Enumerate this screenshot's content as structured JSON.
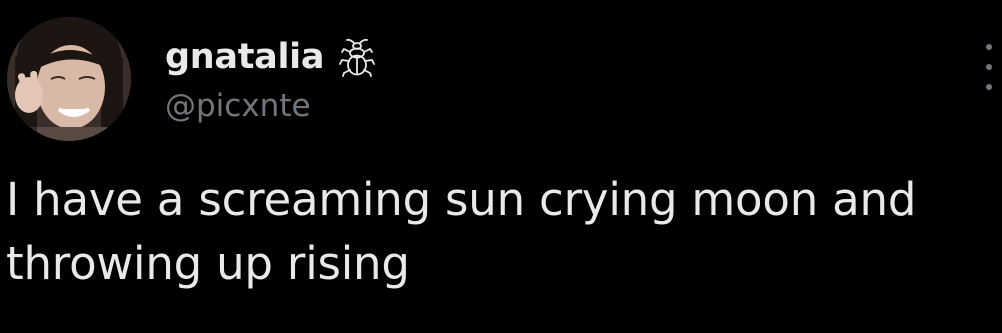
{
  "author": {
    "display_name": "gnatalia",
    "handle": "@picxnte",
    "name_emoji": "beetle-icon",
    "avatar": "profile-photo"
  },
  "post": {
    "text_line_1": "I have a screaming sun crying moon and",
    "text_line_2": "throwing up rising"
  },
  "menu": {
    "icon": "more-vertical-icon"
  },
  "colors": {
    "background": "#000000",
    "primary_text": "#e7e9ea",
    "secondary_text": "#71767b"
  }
}
